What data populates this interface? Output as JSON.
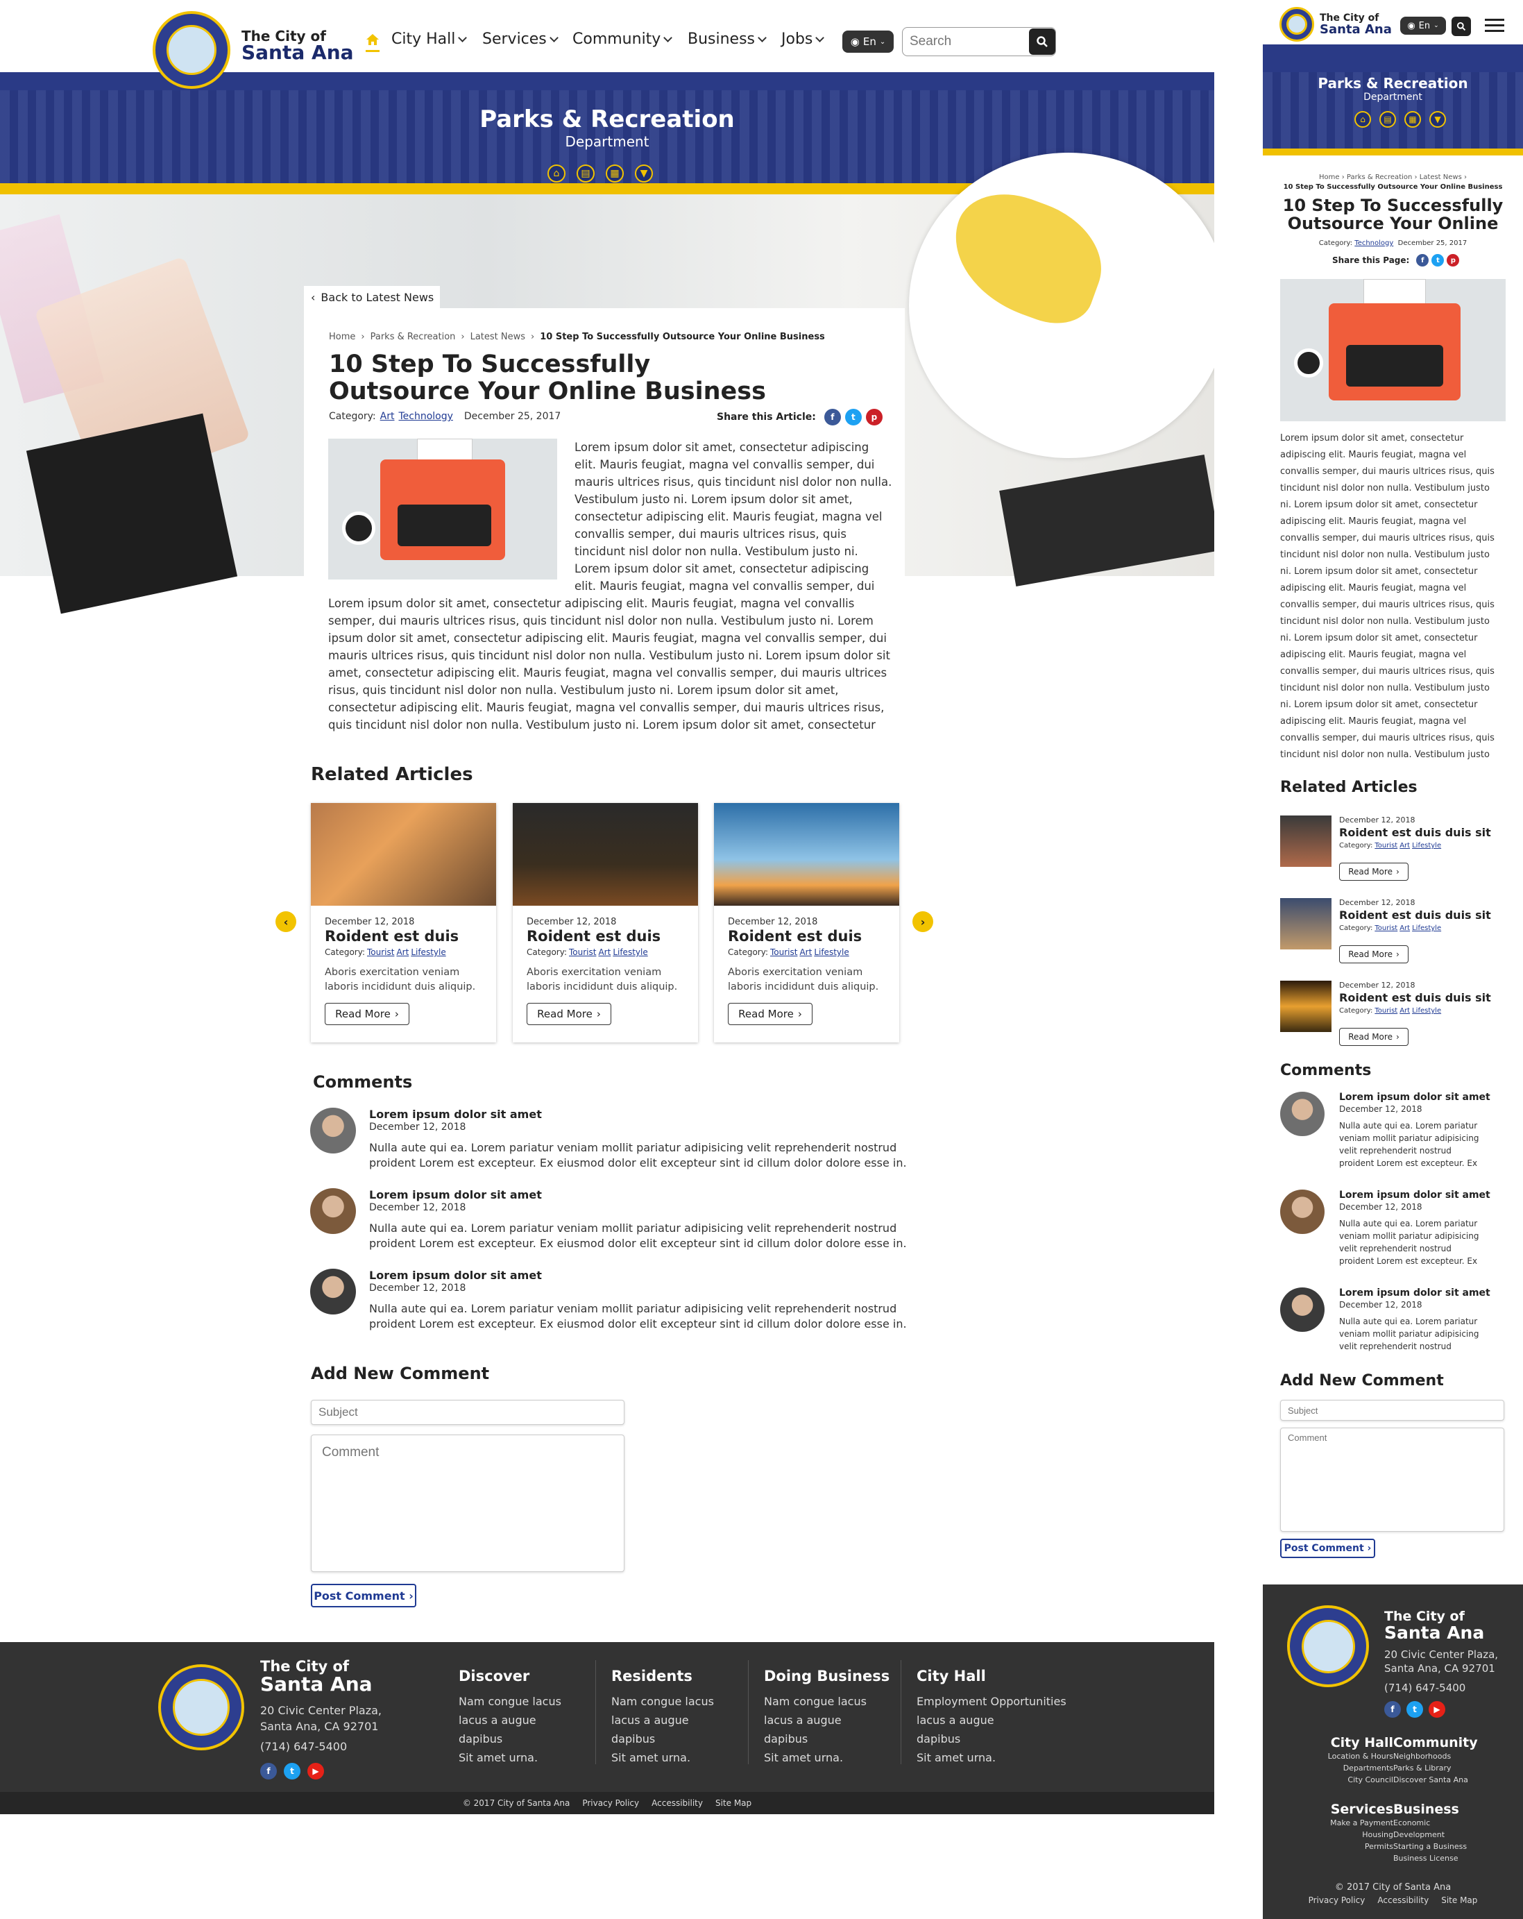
{
  "brand": {
    "line1": "The City of",
    "line2": "Santa Ana"
  },
  "nav": {
    "items": [
      "City Hall",
      "Services",
      "Community",
      "Business",
      "Jobs"
    ],
    "lang": "En",
    "search_placeholder": "Search"
  },
  "hero": {
    "title": "Parks & Recreation",
    "subtitle": "Department"
  },
  "back_link": "Back to Latest News",
  "breadcrumb": {
    "items": [
      "Home",
      "Parks & Recreation",
      "Latest News"
    ],
    "current": "10 Step To Successfully Outsource Your Online Business"
  },
  "article": {
    "title_line1": "10 Step To Successfully",
    "title_line2": "Outsource Your Online Business",
    "category_label": "Category:",
    "categories": [
      "Art",
      "Technology"
    ],
    "date": "December 25, 2017",
    "share_label": "Share this Article:",
    "share_label_mobile": "Share this Page:",
    "body_wrap": [
      "Lorem ipsum dolor sit amet, consectetur adipiscing",
      "elit. Mauris feugiat, magna vel convallis semper, dui",
      "mauris ultrices risus, quis tincidunt nisl dolor non nulla.",
      "Vestibulum justo ni. Lorem ipsum dolor sit amet,",
      "consectetur adipiscing elit. Mauris feugiat, magna vel",
      "convallis semper, dui mauris ultrices risus, quis",
      "tincidunt nisl dolor non nulla. Vestibulum justo ni.",
      "Lorem ipsum dolor sit amet, consectetur adipiscing",
      "elit. Mauris feugiat, magna vel convallis semper, dui"
    ],
    "body_full": [
      "Lorem ipsum dolor sit amet, consectetur adipiscing elit. Mauris feugiat, magna vel convallis",
      "semper, dui mauris ultrices risus, quis tincidunt nisl dolor non nulla. Vestibulum justo ni. Lorem",
      "ipsum dolor sit amet, consectetur adipiscing elit. Mauris feugiat, magna vel convallis semper, dui",
      "mauris ultrices risus, quis tincidunt nisl dolor non nulla. Vestibulum justo ni. Lorem ipsum dolor sit",
      "amet, consectetur adipiscing elit. Mauris feugiat, magna vel convallis semper, dui mauris ultrices",
      "risus, quis tincidunt nisl dolor non nulla. Vestibulum justo ni. Lorem ipsum dolor sit amet,",
      "consectetur adipiscing elit. Mauris feugiat, magna vel convallis semper, dui mauris ultrices risus,",
      "quis tincidunt nisl dolor non nulla. Vestibulum justo ni. Lorem ipsum dolor sit amet, consectetur"
    ]
  },
  "mobile_article": {
    "title_line1": "10 Step To Successfully",
    "title_line2": "Outsource Your Online",
    "breadcrumb_current": "10 Step To Successfully Outsource Your Online Business",
    "body": [
      "Lorem ipsum dolor sit amet, consectetur",
      "adipiscing elit. Mauris feugiat, magna vel",
      "convallis semper, dui mauris ultrices risus, quis",
      "tincidunt nisl dolor non nulla. Vestibulum justo",
      "ni. Lorem ipsum dolor sit amet, consectetur",
      "adipiscing elit. Mauris feugiat, magna vel",
      "convallis semper, dui mauris ultrices risus, quis",
      "tincidunt nisl dolor non nulla. Vestibulum justo",
      "ni. Lorem ipsum dolor sit amet, consectetur",
      "adipiscing elit. Mauris feugiat, magna vel",
      "convallis semper, dui mauris ultrices risus, quis",
      "tincidunt nisl dolor non nulla. Vestibulum justo",
      "ni. Lorem ipsum dolor sit amet, consectetur",
      "adipiscing elit. Mauris feugiat, magna vel",
      "convallis semper, dui mauris ultrices risus, quis",
      "tincidunt nisl dolor non nulla. Vestibulum justo",
      "ni. Lorem ipsum dolor sit amet, consectetur",
      "adipiscing elit. Mauris feugiat, magna vel",
      "convallis semper, dui mauris ultrices risus, quis",
      "tincidunt nisl dolor non nulla. Vestibulum justo"
    ]
  },
  "related": {
    "heading": "Related Articles",
    "category_label": "Category:",
    "tags": [
      "Tourist",
      "Art",
      "Lifestyle"
    ],
    "read_more": "Read More",
    "cards": [
      {
        "date": "December 12, 2018",
        "title": "Roident est duis",
        "text1": "Aboris exercitation veniam",
        "text2": "laboris incididunt duis aliquip."
      },
      {
        "date": "December 12, 2018",
        "title": "Roident est duis",
        "text1": "Aboris exercitation veniam",
        "text2": "laboris incididunt duis aliquip."
      },
      {
        "date": "December 12, 2018",
        "title": "Roident est duis",
        "text1": "Aboris exercitation veniam",
        "text2": "laboris incididunt duis aliquip."
      }
    ],
    "mobile_title": "Roident est duis duis sit"
  },
  "comments": {
    "heading": "Comments",
    "items": [
      {
        "name": "Lorem ipsum dolor sit amet",
        "date": "December 12, 2018",
        "line1": "Nulla aute qui ea. Lorem pariatur veniam mollit pariatur adipisicing velit reprehenderit nostrud",
        "line2": "proident Lorem est excepteur. Ex eiusmod dolor elit excepteur sint id cillum dolor dolore esse in."
      },
      {
        "name": "Lorem ipsum dolor sit amet",
        "date": "December 12, 2018",
        "line1": "Nulla aute qui ea. Lorem pariatur veniam mollit pariatur adipisicing velit reprehenderit nostrud",
        "line2": "proident Lorem est excepteur. Ex eiusmod dolor elit excepteur sint id cillum dolor dolore esse in."
      },
      {
        "name": "Lorem ipsum dolor sit amet",
        "date": "December 12, 2018",
        "line1": "Nulla aute qui ea. Lorem pariatur veniam mollit pariatur adipisicing velit reprehenderit nostrud",
        "line2": "proident Lorem est excepteur. Ex eiusmod dolor elit excepteur sint id cillum dolor dolore esse in."
      }
    ],
    "mobile_lines_a": [
      "Nulla aute qui ea. Lorem pariatur",
      "veniam mollit pariatur adipisicing",
      "velit reprehenderit nostrud",
      "proident Lorem est excepteur. Ex"
    ],
    "mobile_lines_b": [
      "Nulla aute qui ea. Lorem pariatur",
      "veniam mollit pariatur adipisicing",
      "velit reprehenderit nostrud"
    ]
  },
  "add_comment": {
    "heading": "Add New Comment",
    "subject_placeholder": "Subject",
    "comment_placeholder": "Comment",
    "button": "Post Comment"
  },
  "footer": {
    "address1": "20 Civic Center Plaza,",
    "address2": "Santa Ana, CA 92701",
    "phone": "(714) 647-5400",
    "columns": [
      {
        "title": "Discover",
        "items": [
          "Nam congue lacus",
          "lacus a augue",
          "dapibus",
          "Sit amet urna."
        ]
      },
      {
        "title": "Residents",
        "items": [
          "Nam congue lacus",
          "lacus a augue",
          "dapibus",
          "Sit amet urna."
        ]
      },
      {
        "title": "Doing Business",
        "items": [
          "Nam congue lacus",
          "lacus a augue",
          "dapibus",
          "Sit amet urna."
        ]
      },
      {
        "title": "City Hall",
        "items": [
          "Employment Opportunities",
          "lacus a augue",
          "dapibus",
          "Sit amet urna."
        ]
      }
    ],
    "copyright": "© 2017 City of Santa Ana",
    "links": [
      "Privacy Policy",
      "Accessibility",
      "Site Map"
    ],
    "mobile_groups": [
      {
        "title": "City Hall",
        "items": [
          "Location & Hours",
          "Departments",
          "City Council"
        ]
      },
      {
        "title": "Community",
        "items": [
          "Neighborhoods",
          "Parks & Library",
          "Discover Santa Ana"
        ]
      },
      {
        "title": "Services",
        "items": [
          "Make a Payment",
          "Housing",
          "Permits"
        ]
      },
      {
        "title": "Business",
        "items": [
          "Economic Development",
          "Starting a Business",
          "Business License"
        ]
      }
    ]
  },
  "colors": {
    "navy": "#2a3a86",
    "gold": "#f2c300",
    "footer": "#333333",
    "link": "#1f3a93"
  },
  "icons": [
    "home-icon",
    "chevron-down-icon",
    "globe-icon",
    "search-icon",
    "menu-icon",
    "facebook-icon",
    "twitter-icon",
    "pinterest-icon",
    "youtube-icon"
  ]
}
